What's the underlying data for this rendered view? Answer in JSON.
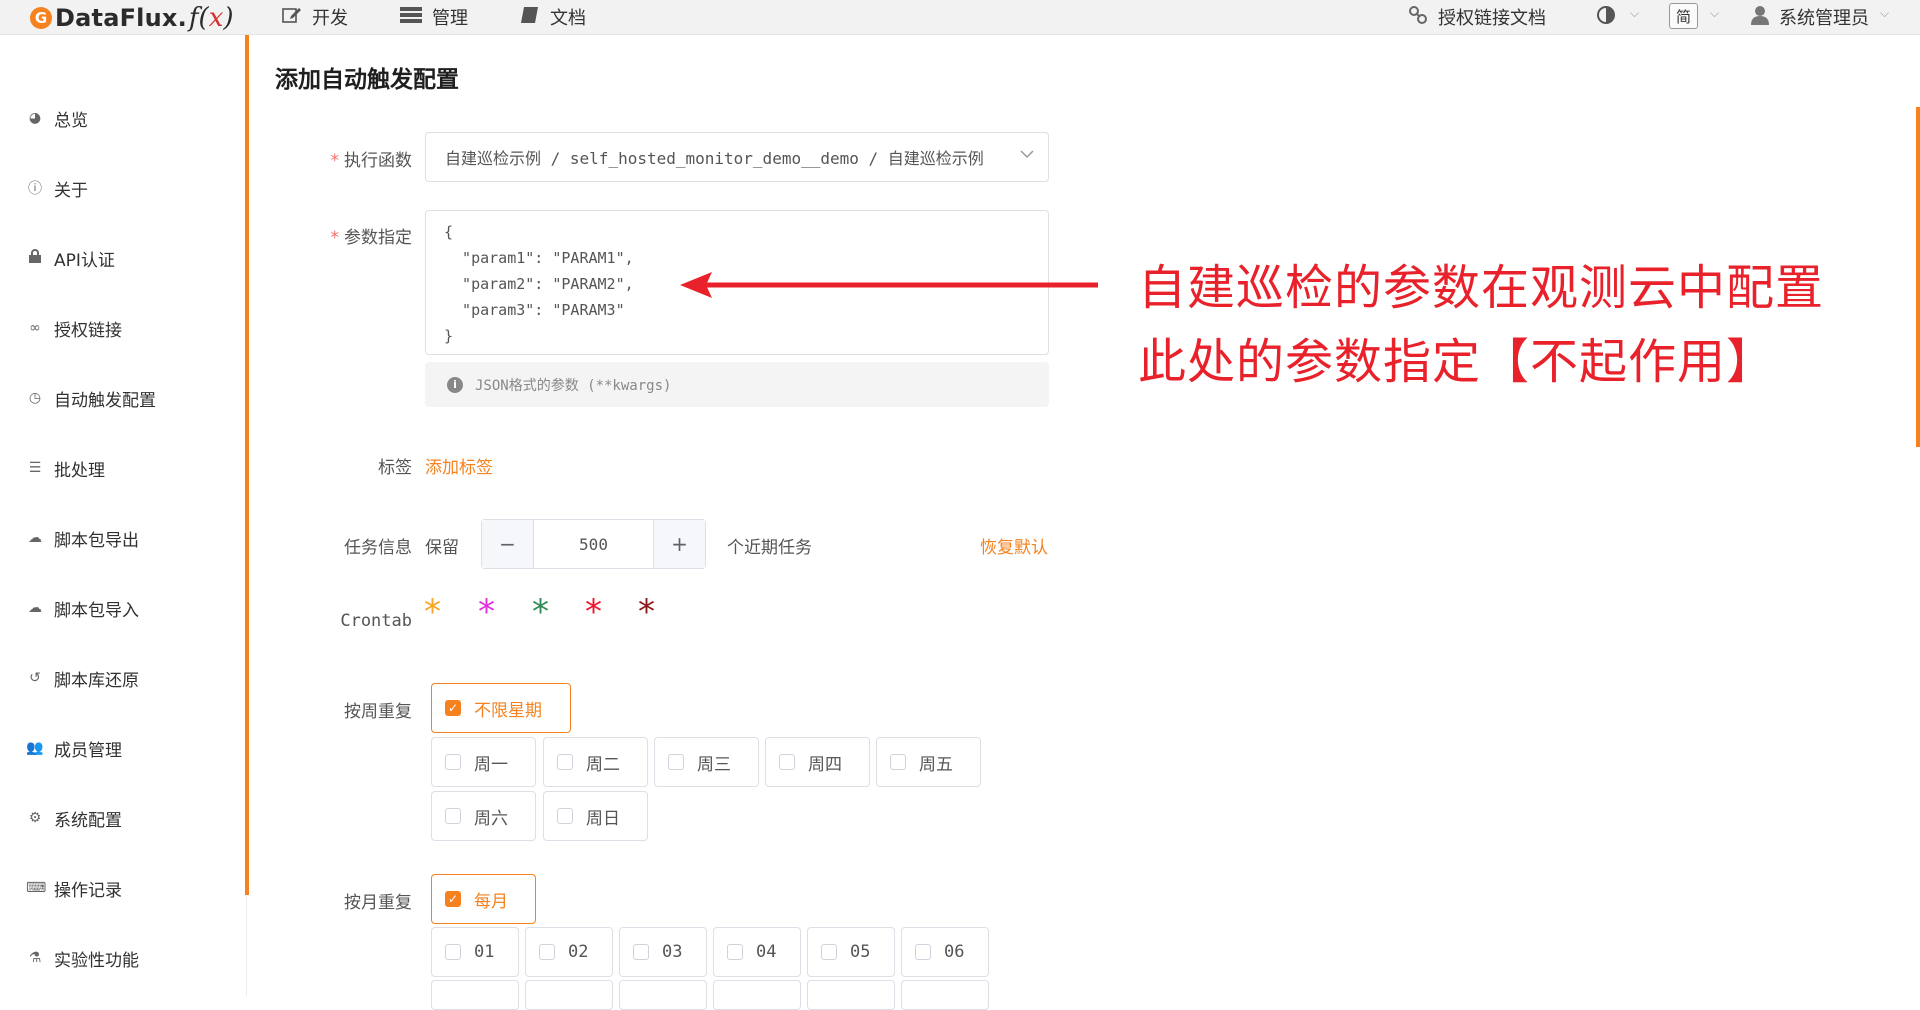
{
  "app": {
    "logo_name": "DataFlux",
    "logo_suffix": ".",
    "logo_fx": "f",
    "logo_x": "x"
  },
  "topnav": {
    "items": [
      {
        "label": "开发",
        "icon": "edit-icon"
      },
      {
        "label": "管理",
        "icon": "manage-icon"
      },
      {
        "label": "文档",
        "icon": "book-icon"
      }
    ],
    "auth_docs": "授权链接文档",
    "lang": "简",
    "user": "系统管理员"
  },
  "sidebar": {
    "items": [
      {
        "label": "总览",
        "icon": "dashboard-icon"
      },
      {
        "label": "关于",
        "icon": "info-icon"
      },
      {
        "label": "API认证",
        "icon": "lock-icon"
      },
      {
        "label": "授权链接",
        "icon": "link-icon"
      },
      {
        "label": "自动触发配置",
        "icon": "clock-icon"
      },
      {
        "label": "批处理",
        "icon": "batch-icon"
      },
      {
        "label": "脚本包导出",
        "icon": "cloud-download-icon"
      },
      {
        "label": "脚本包导入",
        "icon": "cloud-upload-icon"
      },
      {
        "label": "脚本库还原",
        "icon": "history-icon"
      },
      {
        "label": "成员管理",
        "icon": "users-icon"
      },
      {
        "label": "系统配置",
        "icon": "gear-icon"
      },
      {
        "label": "操作记录",
        "icon": "keyboard-icon"
      },
      {
        "label": "实验性功能",
        "icon": "flask-icon"
      }
    ]
  },
  "form": {
    "title": "添加自动触发配置",
    "func_label": "执行函数",
    "func_value": "自建巡检示例 / self_hosted_monitor_demo__demo / 自建巡检示例",
    "params_label": "参数指定",
    "params_value": "{\n  \"param1\": \"PARAM1\",\n  \"param2\": \"PARAM2\",\n  \"param3\": \"PARAM3\"\n}",
    "params_hint": "JSON格式的参数 (**kwargs)",
    "tags_label": "标签",
    "add_tag": "添加标签",
    "task_label": "任务信息",
    "keep": "保留",
    "keep_value": "500",
    "recent": "个近期任务",
    "restore": "恢复默认",
    "crontab_label": "Crontab",
    "crontab_stars": [
      {
        "char": "*",
        "color": "#f5a623"
      },
      {
        "char": "*",
        "color": "#e02fd6"
      },
      {
        "char": "*",
        "color": "#2e8b57"
      },
      {
        "char": "*",
        "color": "#f0142c"
      },
      {
        "char": "*",
        "color": "#8b1a1a"
      }
    ],
    "weekly_label": "按周重复",
    "weekly_all": "不限星期",
    "weekdays": [
      "周一",
      "周二",
      "周三",
      "周四",
      "周五",
      "周六",
      "周日"
    ],
    "monthly_label": "按月重复",
    "monthly_all": "每月",
    "months": [
      "01",
      "02",
      "03",
      "04",
      "05",
      "06"
    ]
  },
  "annotation": {
    "line1": "自建巡检的参数在观测云中配置",
    "line2": "此处的参数指定【不起作用】",
    "color": "#e8212b"
  },
  "colors": {
    "accent": "#f5821f",
    "required": "#f56c6c"
  }
}
